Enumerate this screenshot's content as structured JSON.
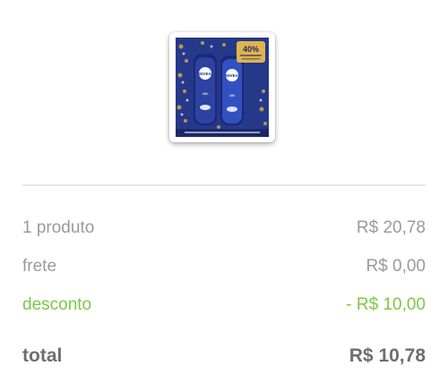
{
  "product": {
    "image_alt": "NIVEA",
    "promo_badge": "40%",
    "brand_text": "NIVEA",
    "colors": {
      "box_blue": "#26388a",
      "badge_gold": "#e0b44a"
    }
  },
  "summary": {
    "products": {
      "label": "1 produto",
      "value": "R$ 20,78"
    },
    "shipping": {
      "label": "frete",
      "value": "R$ 0,00"
    },
    "discount": {
      "label": "desconto",
      "value": "- R$ 10,00"
    },
    "total": {
      "label": "total",
      "value": "R$ 10,78"
    }
  },
  "colors": {
    "muted_text": "#9a9a9a",
    "discount_green": "#7ac943",
    "total_text": "#6e6e6e",
    "divider": "#e6e6e6"
  }
}
